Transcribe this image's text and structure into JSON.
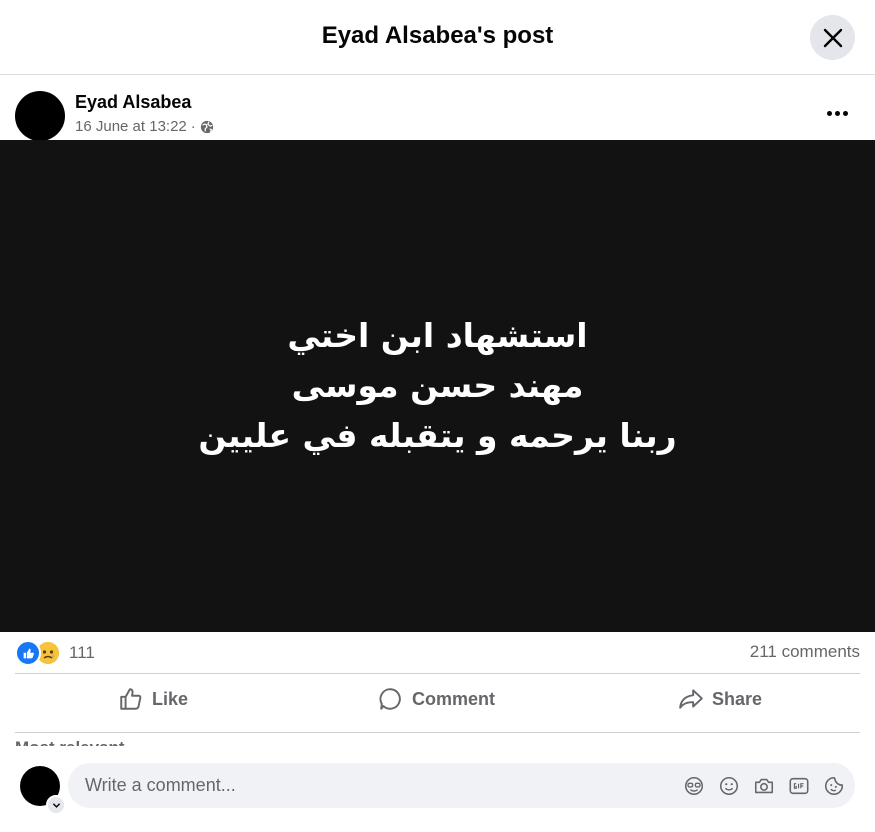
{
  "header": {
    "title": "Eyad Alsabea's post"
  },
  "post": {
    "author": "Eyad Alsabea",
    "timestamp": "16 June at 13:22",
    "meta_separator": "·",
    "audience_icon": "globe-icon",
    "image_text": {
      "line1": "استشهاد ابن اختي",
      "line2": "مهند حسن موسى",
      "line3": "ربنا يرحمه و يتقبله في عليين"
    },
    "image_background": "#121212"
  },
  "stats": {
    "reaction_icons": [
      "like-reaction-icon",
      "sad-reaction-icon"
    ],
    "reaction_count": "111",
    "comments": "211 comments"
  },
  "actions": {
    "like": "Like",
    "comment": "Comment",
    "share": "Share"
  },
  "comments_filter": {
    "label": "Most relevant"
  },
  "comment_input": {
    "placeholder": "Write a comment...",
    "icons": [
      "avatar-sticker-icon",
      "emoji-icon",
      "camera-icon",
      "gif-icon",
      "sticker-icon"
    ]
  },
  "colors": {
    "accent": "#1877f2",
    "secondary_text": "#65676b",
    "divider": "#ced0d4",
    "input_bg": "#f0f2f5"
  }
}
